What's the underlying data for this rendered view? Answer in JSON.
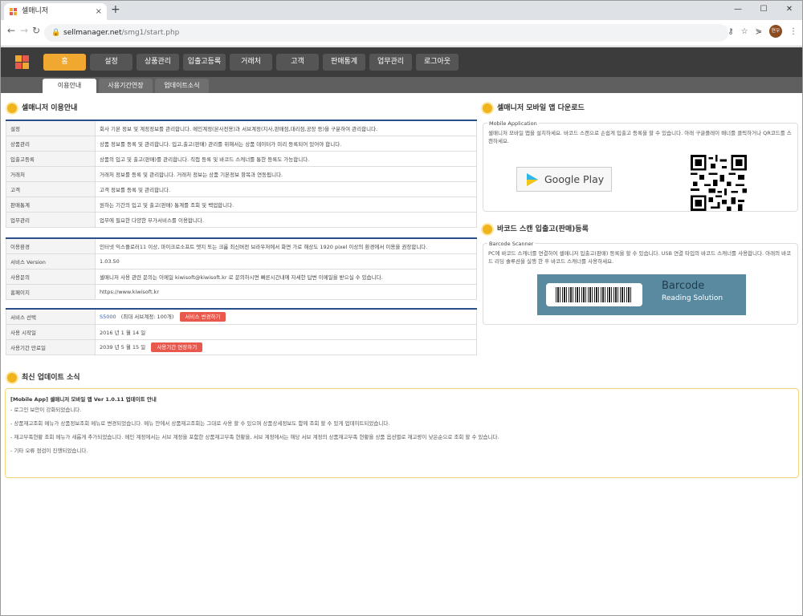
{
  "browser": {
    "tab_title": "셀매니저",
    "tab_close": "×",
    "new_tab": "+",
    "url_host": "sellmanager.net",
    "url_path": "/smg1/start.php",
    "window_controls": [
      "—",
      "☐",
      "✕"
    ],
    "profile": "현우"
  },
  "appnav": {
    "menu": [
      "홈",
      "설정",
      "상품관리",
      "입출고등록",
      "거래처",
      "고객",
      "판매통계",
      "업무관리",
      "로그아웃"
    ],
    "active_index": 0,
    "colors": {
      "active": "#f0a830",
      "bar": "#3c3c3c"
    }
  },
  "subnav": {
    "tabs": [
      "이용안내",
      "사용기간연장",
      "업데이트소식"
    ],
    "active_index": 0
  },
  "guide": {
    "title": "셀매니저 이용안내",
    "rows": [
      [
        "설정",
        "회사 기본 정보 및 계정정보를 관리합니다. 메인계정(본사전용)과 서브계정(지사,판매점,대리점,공장 등)을 구분하여 관리합니다."
      ],
      [
        "상품관리",
        "상품 정보를 등록 및 관리합니다. 입고,출고(판매) 관리를 위해서는 상품 데이터가 미리 등록되어 있어야 합니다."
      ],
      [
        "입출고등록",
        "상품의 입고 및 출고(판매)를 관리합니다. 직접 등록 및 바코드 스캐너를 통한 등록도 가능합니다."
      ],
      [
        "거래처",
        "거래처 정보를 등록 및 관리합니다. 거래처 정보는 상품 기본정보 항목과 연동됩니다."
      ],
      [
        "고객",
        "고객 정보를 등록 및 관리합니다."
      ],
      [
        "판매통계",
        "원하는 기간의 입고 및 출고(판매) 통계를 조회 및 백업합니다."
      ],
      [
        "업무관리",
        "업무에 필요한 다양한 부가서비스를 이용합니다."
      ]
    ]
  },
  "system": {
    "rows": [
      [
        "이용환경",
        "인터넷 익스플로러11 이상, 마이크로소프트 엣지 또는 크롬 최신버전 브라우저에서 화면 가로 해상도 1920 pixel 이상의 환경에서 이용을 권장합니다."
      ],
      [
        "서비스 Version",
        "1.03.50"
      ],
      [
        "사용문의",
        "셀매니저 사용 관련 문의는 이메일 kiwisoft@kiwisoft.kr 로 문의하시면 빠른시간내에 자세한 답변 이메일을 받으실 수 있습니다."
      ],
      [
        "홈페이지",
        "https://www.kiwisoft.kr"
      ]
    ]
  },
  "service": {
    "select_label": "서비스 선택",
    "plan": "S5000",
    "plan_note": "(최대 서브계정: 100개)",
    "change_button": "서비스 변경하기",
    "start_label": "사용 시작일",
    "start_date": "2016 년 1 월 14 일",
    "end_label": "사용기간 만료일",
    "end_date": "2039 년 5 월 15 일",
    "extend_button": "사용기간 연장하기"
  },
  "mobile": {
    "title": "셀매니저 모바일 앱 다운로드",
    "legend": "Mobile Application",
    "text": "셀매니저 모바일 앱을 설치하세요. 바코드 스캔으로 손쉽게 입출고 등록을 할 수 있습니다. 아래 구글플레이 배너를 클릭하거나 QR코드를 스캔하세요.",
    "store_button": "Google Play"
  },
  "barcode": {
    "title": "바코드 스캔 입출고(판매)등록",
    "legend": "Barcode Scanner",
    "text": "PC에 바코드 스캐너를 연결하여 셀매니저 입출고(판매) 등록을 할 수 있습니다. USB 연결 타입의 바코드 스캐너를 사용합니다. 아래의 바코드 리딩 솔루션을 실행 한 후 바코드 스캐너를 사용하세요.",
    "banner_title": "Barcode",
    "banner_subtitle": "Reading Solution"
  },
  "updates": {
    "title": "최신 업데이트 소식",
    "headline": "[Mobile App] 셀매니저 모바일 앱 Ver 1.0.11 업데이트 안내",
    "items": [
      "- 로그인 보안이 강화되었습니다.",
      "- 상품재고조회 메뉴가 상품정보조회 메뉴로 변경되었습니다. 메뉴 안에서 상품재고조회는 그대로 사용 할 수 있으며 상품상세정보도 함께 조회 할 수 있게 업데이트되었습니다.",
      "- 재고부족현황 조회 메뉴가 새롭게 추가되었습니다. 메인 계정에서는 서브 계정을 포함한 상품재고부족 현황을, 서브 계정에서는 해당 서브 계정의 상품재고부족 현황을 상품 옵션별로 재고량이 낮은순으로 조회 할 수 있습니다.",
      "- 기타 오류 점검이 진행되었습니다."
    ]
  }
}
